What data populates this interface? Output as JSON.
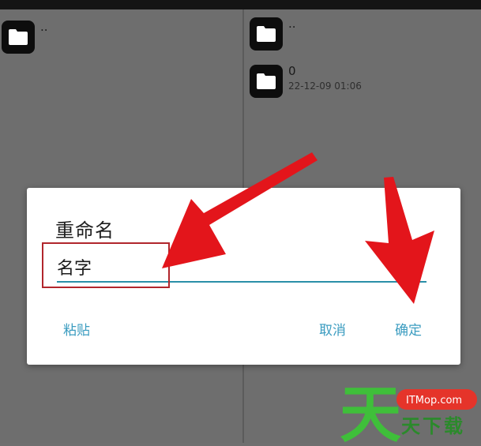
{
  "left_pane": {
    "items": [
      {
        "name": "..",
        "icon": "folder-icon"
      }
    ]
  },
  "right_pane": {
    "items": [
      {
        "name": "..",
        "icon": "folder-icon"
      },
      {
        "name": "0",
        "date": "22-12-09 01:06",
        "icon": "folder-icon"
      }
    ]
  },
  "dialog": {
    "title": "重命名",
    "input_value": "名字",
    "paste_label": "粘贴",
    "cancel_label": "取消",
    "ok_label": "确定"
  },
  "colors": {
    "accent": "#2a8fa8",
    "button_text": "#3b9cc0",
    "arrow": "#e3151b",
    "highlight": "#b1262c"
  },
  "watermark": {
    "site": "ITMop.com",
    "brand": "天下载",
    "logo": "天"
  }
}
